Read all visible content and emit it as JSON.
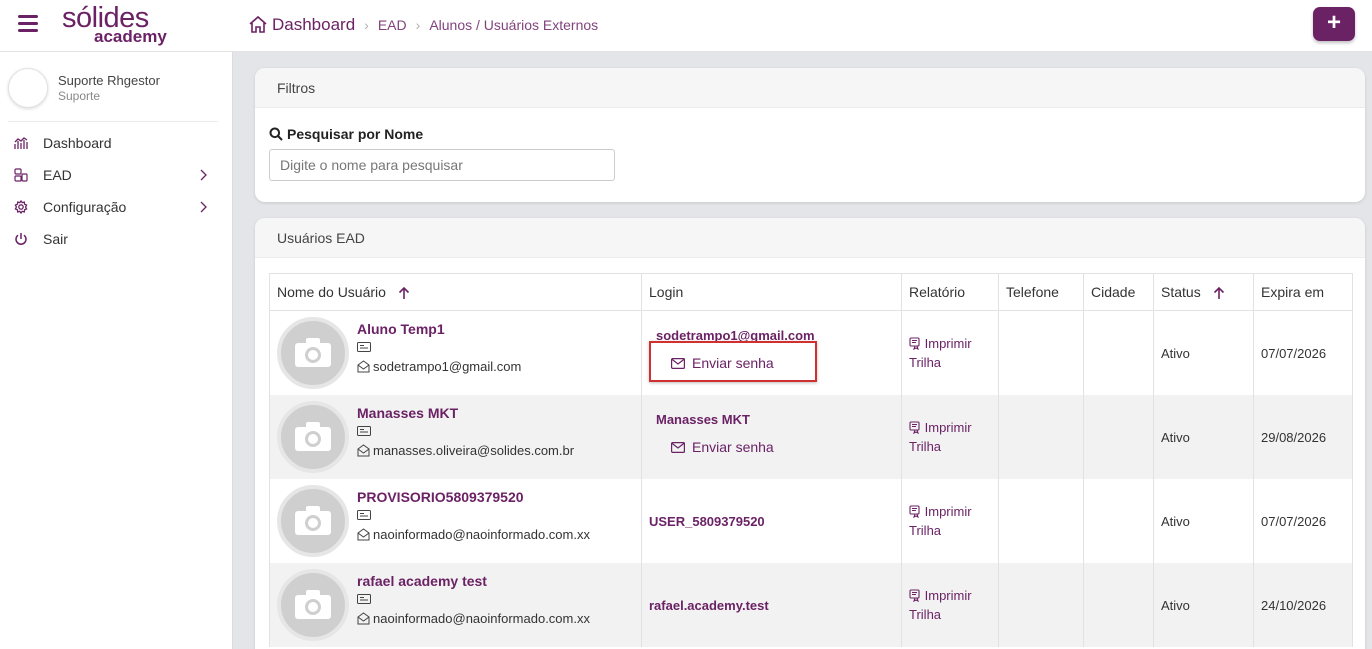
{
  "header": {
    "logo_top": "sólides",
    "logo_bottom": "academy",
    "breadcrumb_main": "Dashboard",
    "breadcrumb_1": "EAD",
    "breadcrumb_2": "Alunos / Usuários Externos",
    "add_label": "+"
  },
  "sidebar": {
    "user_name": "Suporte Rhgestor",
    "user_role": "Suporte",
    "items": [
      {
        "label": "Dashboard",
        "icon": "chart-icon"
      },
      {
        "label": "EAD",
        "icon": "ead-icon"
      },
      {
        "label": "Configuração",
        "icon": "gear-icon"
      },
      {
        "label": "Sair",
        "icon": "power-icon"
      }
    ]
  },
  "filters": {
    "title": "Filtros",
    "search_label": "Pesquisar por Nome",
    "search_placeholder": "Digite o nome para pesquisar"
  },
  "users": {
    "title": "Usuários EAD",
    "columns": [
      "Nome do Usuário",
      "Login",
      "Relatório",
      "Telefone",
      "Cidade",
      "Status",
      "Expira em"
    ],
    "send_password_label": "Enviar senha",
    "report_label_1": "Imprimir",
    "report_label_2": "Trilha",
    "rows": [
      {
        "name": "Aluno Temp1",
        "email": "sodetrampo1@gmail.com",
        "login": "sodetrampo1@gmail.com",
        "status": "Ativo",
        "expires": "07/07/2026"
      },
      {
        "name": "Manasses MKT",
        "email": "manasses.oliveira@solides.com.br",
        "login": "Manasses MKT",
        "status": "Ativo",
        "expires": "29/08/2026"
      },
      {
        "name": "PROVISORIO5809379520",
        "email": "naoinformado@naoinformado.com.xx",
        "login": "USER_5809379520",
        "status": "Ativo",
        "expires": "07/07/2026"
      },
      {
        "name": "rafael academy test",
        "email": "naoinformado@naoinformado.com.xx",
        "login": "rafael.academy.test",
        "status": "Ativo",
        "expires": "24/10/2026"
      }
    ]
  },
  "colors": {
    "brand": "#6b2265",
    "highlight": "#d03030"
  }
}
